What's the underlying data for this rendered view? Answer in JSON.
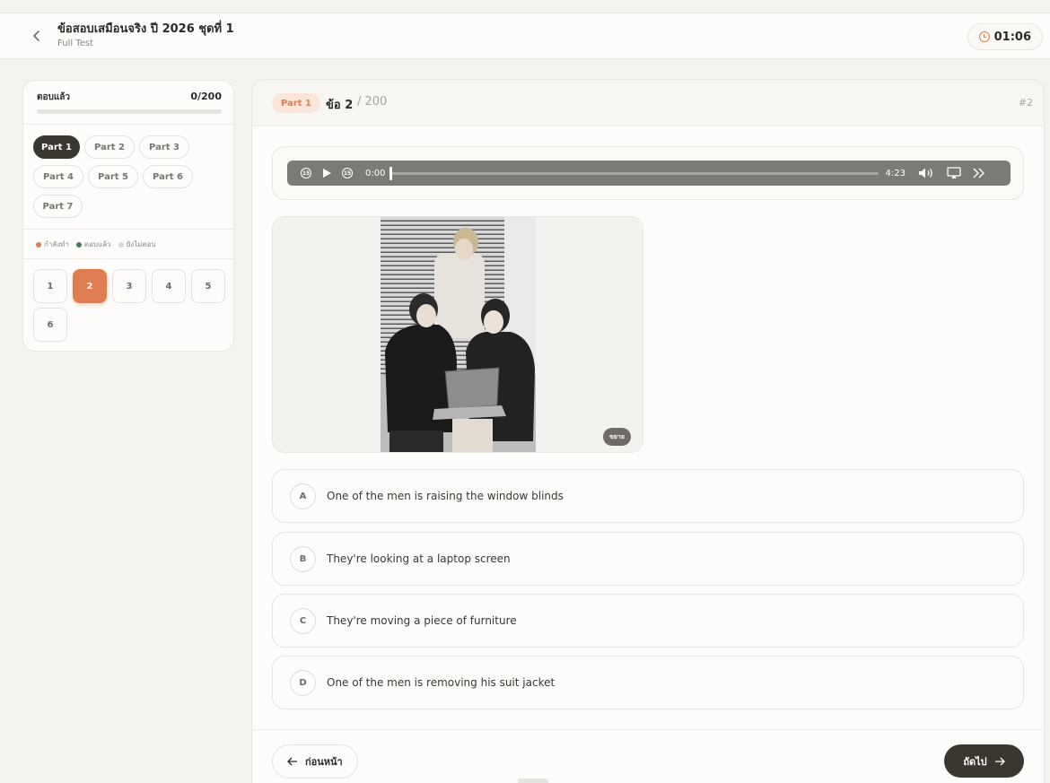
{
  "header": {
    "back_icon": "chevron-left-icon",
    "title": "ข้อสอบเสมือนจริง ปี 2026 ชุดที่ 1",
    "subtitle": "Full Test",
    "timer_icon": "clock-icon",
    "timer": "01:06",
    "accent": "#e07d50"
  },
  "sidebar": {
    "answered_label": "ตอบแล้ว",
    "answered_count": "0/200",
    "progress": 0,
    "parts": [
      "Part 1",
      "Part 2",
      "Part 3",
      "Part 4",
      "Part 5",
      "Part 6",
      "Part 7"
    ],
    "active_part": "Part 1",
    "legend": {
      "current": "กำลังทำ",
      "answered": "ตอบแล้ว",
      "unanswered": "ยังไม่ตอบ",
      "current_color": "#e07d50",
      "answered_color": "#4a7a5c",
      "unanswered_color": "#d9d7d2"
    },
    "questions": [
      "1",
      "2",
      "3",
      "4",
      "5",
      "6"
    ],
    "current_question": "2"
  },
  "main": {
    "part_badge": "Part 1",
    "question_label": "ข้อ 2",
    "question_total": "/ 200",
    "question_ref": "#2",
    "audio": {
      "rewind_icon": "rewind-15-icon",
      "play_icon": "play-icon",
      "forward_icon": "forward-15-icon",
      "current_time": "0:00",
      "duration": "4:23",
      "progress": 0,
      "volume_icon": "volume-icon",
      "airplay_icon": "airplay-icon",
      "more_icon": "double-chevron-right-icon"
    },
    "image": {
      "subject": "office-photo",
      "zoom_label": "ขยาย"
    },
    "options": [
      {
        "letter": "A",
        "text": "One of the men is raising the window blinds"
      },
      {
        "letter": "B",
        "text": "They're looking at a laptop screen"
      },
      {
        "letter": "C",
        "text": "They're moving a piece of furniture"
      },
      {
        "letter": "D",
        "text": "One of the men is removing his suit jacket"
      }
    ],
    "prev_label": "ก่อนหน้า",
    "next_label": "ถัดไป",
    "prev_icon": "arrow-left-icon",
    "next_icon": "arrow-right-icon"
  }
}
